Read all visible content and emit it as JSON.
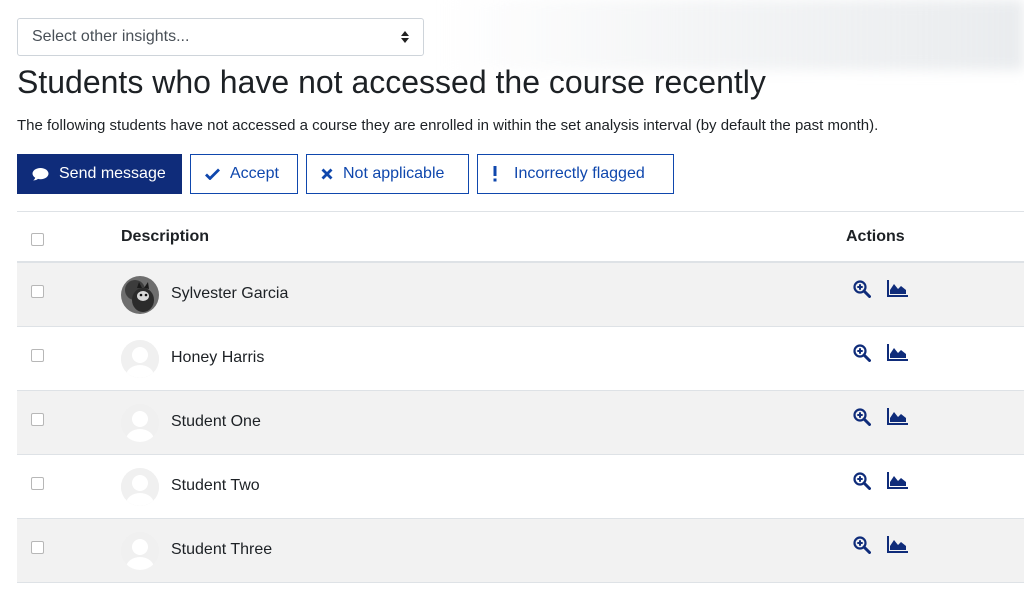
{
  "insights_select": {
    "selected": "Select other insights..."
  },
  "page_title": "Students who have not accessed the course recently",
  "description": "The following students have not accessed a course they are enrolled in within the set analysis interval (by default the past month).",
  "actions_bar": {
    "send_message": "Send message",
    "accept": "Accept",
    "not_applicable": "Not applicable",
    "incorrectly_flagged": "Incorrectly flagged"
  },
  "table": {
    "headers": {
      "description": "Description",
      "actions": "Actions"
    },
    "rows": [
      {
        "name": "Sylvester Garcia",
        "avatar": "photo"
      },
      {
        "name": "Honey Harris",
        "avatar": "default"
      },
      {
        "name": "Student One",
        "avatar": "default"
      },
      {
        "name": "Student Two",
        "avatar": "default"
      },
      {
        "name": "Student Three",
        "avatar": "default"
      }
    ]
  },
  "icons": {
    "send_message": "comment-icon",
    "accept": "check-icon",
    "not_applicable": "times-icon",
    "incorrectly_flagged": "exclamation-icon",
    "view_details": "zoom-in-icon",
    "insight_chart": "area-chart-icon"
  },
  "colors": {
    "primary": "#0f2c7a",
    "link": "#0f47ad",
    "row_striped": "#f2f2f2"
  }
}
